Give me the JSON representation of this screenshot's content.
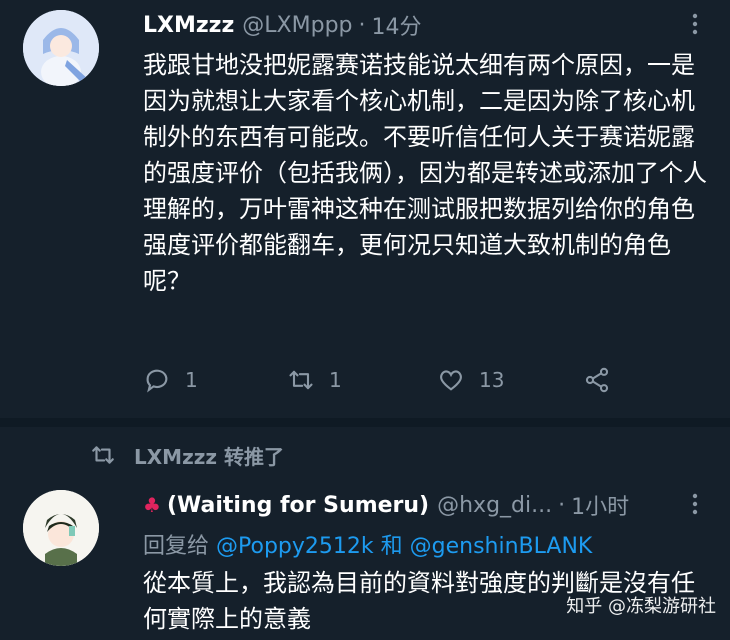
{
  "tweet": {
    "author_name": "LXMzzz",
    "handle": "@LXMppp",
    "separator": "·",
    "time": "14分",
    "text": "我跟甘地没把妮露赛诺技能说太细有两个原因，一是因为就想让大家看个核心机制，二是因为除了核心机制外的东西有可能改。不要听信任何人关于赛诺妮露的强度评价（包括我俩），因为都是转述或添加了个人理解的，万叶雷神这种在测试服把数据列给你的角色强度评价都能翻车，更何况只知道大致机制的角色呢？",
    "reply_count": "1",
    "retweet_count": "1",
    "like_count": "13"
  },
  "retweet_banner": {
    "label": "LXMzzz 转推了"
  },
  "tweet2": {
    "author_name": "(Waiting for Sumeru)",
    "handle": "@hxg_di...",
    "separator": "·",
    "time": "1小时",
    "reply_prefix": "回复给",
    "mention1": "@Poppy2512k",
    "and": "和",
    "mention2": "@genshinBLANK",
    "text": "從本質上，我認為目前的資料對強度的判斷是沒有任何實際上的意義"
  },
  "watermark": "知乎 @冻梨游研社",
  "colors": {
    "background": "#15202b",
    "muted": "#8b98a5",
    "link": "#1d9bf0",
    "maple": "#e0245e"
  },
  "icons": [
    "more-icon",
    "reply-icon",
    "retweet-icon",
    "like-icon",
    "share-icon",
    "maple-leaf-icon"
  ]
}
